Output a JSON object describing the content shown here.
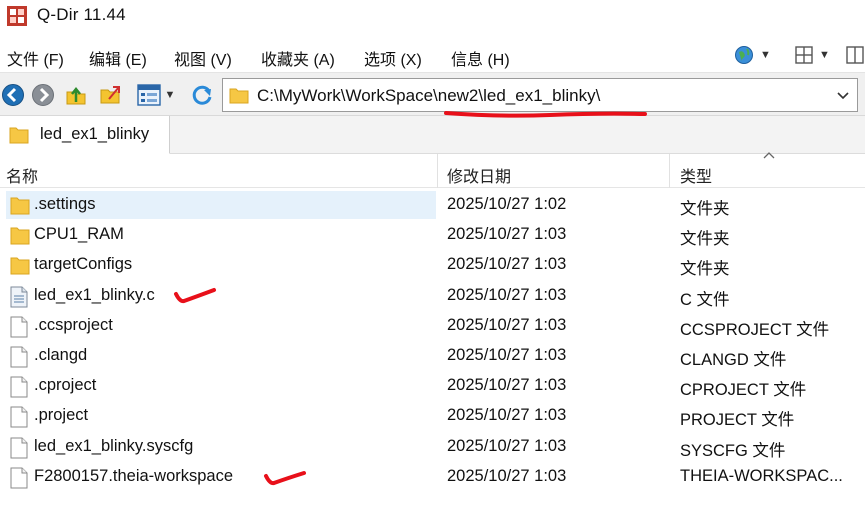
{
  "window": {
    "title": "Q-Dir 11.44",
    "app_icon": "qdir-app-icon"
  },
  "menu": {
    "items": [
      {
        "label": "文件 (F)",
        "name": "menu-file"
      },
      {
        "label": "编辑 (E)",
        "name": "menu-edit"
      },
      {
        "label": "视图 (V)",
        "name": "menu-view"
      },
      {
        "label": "收藏夹 (A)",
        "name": "menu-favorites"
      },
      {
        "label": "选项 (X)",
        "name": "menu-options"
      },
      {
        "label": "信息 (H)",
        "name": "menu-info"
      }
    ],
    "right_icons": [
      "globe-icon",
      "layout-grid-icon",
      "window-icon"
    ]
  },
  "toolbar": {
    "icons": [
      "back-icon",
      "forward-icon",
      "up-folder-icon",
      "folder-sync-icon",
      "view-mode-icon",
      "refresh-icon"
    ]
  },
  "address": {
    "path": "C:\\MyWork\\WorkSpace\\new2\\led_ex1_blinky\\"
  },
  "tab": {
    "label": "led_ex1_blinky"
  },
  "columns": {
    "name": "名称",
    "date": "修改日期",
    "type": "类型"
  },
  "files": [
    {
      "name": ".settings",
      "date": "2025/10/27 1:02",
      "type": "文件夹",
      "icon": "folder-icon",
      "selected": true
    },
    {
      "name": "CPU1_RAM",
      "date": "2025/10/27 1:03",
      "type": "文件夹",
      "icon": "folder-icon"
    },
    {
      "name": "targetConfigs",
      "date": "2025/10/27 1:03",
      "type": "文件夹",
      "icon": "folder-icon"
    },
    {
      "name": "led_ex1_blinky.c",
      "date": "2025/10/27 1:03",
      "type": "C 文件",
      "icon": "c-source-file-icon"
    },
    {
      "name": ".ccsproject",
      "date": "2025/10/27 1:03",
      "type": "CCSPROJECT 文件",
      "icon": "file-icon"
    },
    {
      "name": ".clangd",
      "date": "2025/10/27 1:03",
      "type": "CLANGD 文件",
      "icon": "file-icon"
    },
    {
      "name": ".cproject",
      "date": "2025/10/27 1:03",
      "type": "CPROJECT 文件",
      "icon": "file-icon"
    },
    {
      "name": ".project",
      "date": "2025/10/27 1:03",
      "type": "PROJECT 文件",
      "icon": "file-icon"
    },
    {
      "name": "led_ex1_blinky.syscfg",
      "date": "2025/10/27 1:03",
      "type": "SYSCFG 文件",
      "icon": "file-icon"
    },
    {
      "name": "F2800157.theia-workspace",
      "date": "2025/10/27 1:03",
      "type": "THEIA-WORKSPAC...",
      "icon": "file-icon"
    }
  ],
  "annotations": {
    "color": "#e8101a"
  }
}
